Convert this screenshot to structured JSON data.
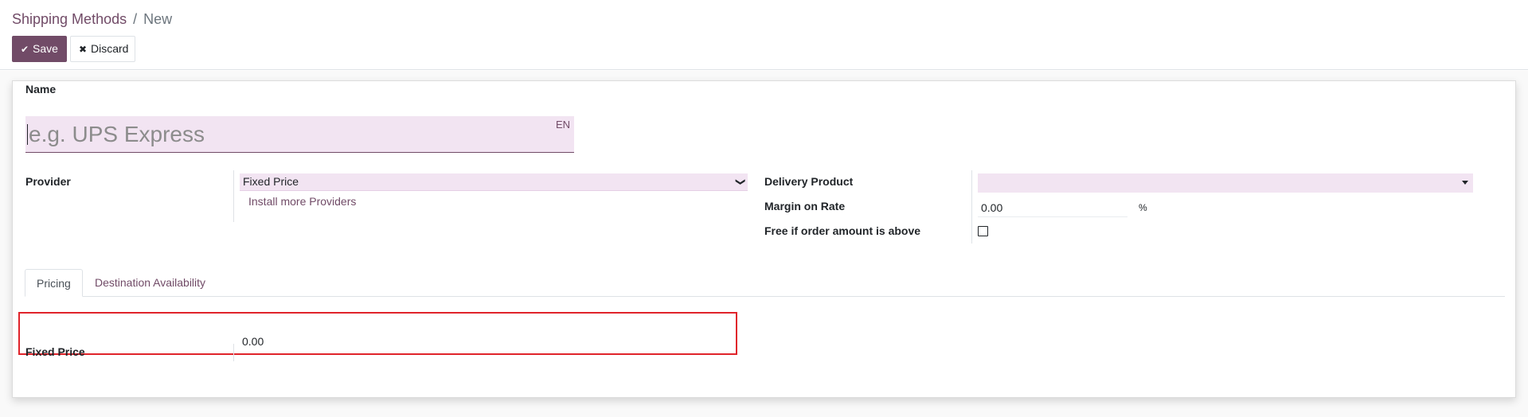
{
  "breadcrumb": {
    "parent": "Shipping Methods",
    "separator": "/",
    "current": "New"
  },
  "toolbar": {
    "save_label": "Save",
    "save_icon": "✔",
    "discard_label": "Discard",
    "discard_icon": "✖"
  },
  "form": {
    "name_label": "Name",
    "name_placeholder": "e.g. UPS Express",
    "name_value": "",
    "lang_badge": "EN",
    "provider_label": "Provider",
    "provider_value": "Fixed Price",
    "install_link": "Install more Providers",
    "delivery_product_label": "Delivery Product",
    "delivery_product_value": "",
    "margin_label": "Margin on Rate",
    "margin_value": "0.00",
    "margin_unit": "%",
    "free_label": "Free if order amount is above",
    "free_checked": false
  },
  "tabs": [
    {
      "label": "Pricing",
      "active": true
    },
    {
      "label": "Destination Availability",
      "active": false
    }
  ],
  "pricing": {
    "fixed_price_label": "Fixed Price",
    "fixed_price_value": "0.00"
  },
  "icons": {
    "save": "check-icon",
    "discard": "close-icon",
    "dropdown": "chevron-down-icon"
  },
  "colors": {
    "brand": "#714B67",
    "field_bg": "#f2e4f2",
    "highlight": "#e0242b"
  }
}
